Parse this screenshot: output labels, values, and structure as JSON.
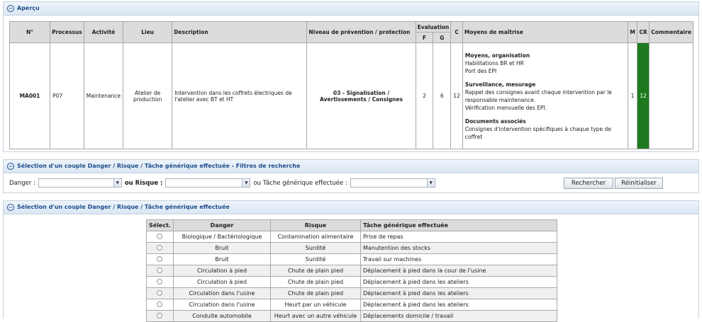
{
  "apercu": {
    "title": "Aperçu",
    "headers": {
      "num": "N°",
      "processus": "Processus",
      "activite": "Activité",
      "lieu": "Lieu",
      "description": "Description",
      "niveau": "Niveau de prévention / protection",
      "evaluation": "Evaluation",
      "f": "F",
      "g": "G",
      "c": "C",
      "moyens": "Moyens de maîtrise",
      "m": "M",
      "cr": "CR",
      "commentaire": "Commentaire"
    },
    "row": {
      "num": "MA001",
      "processus": "P07",
      "activite": "Maintenance",
      "lieu": "Atelier de production",
      "description": "Intervention dans les coffrets électriques de l'atelier avec BT et HT",
      "niveau": "03 - Signalisation / Avertissements / Consignes",
      "f": "2",
      "g": "6",
      "c": "12",
      "m": "1",
      "cr": "12",
      "commentaire": "",
      "moyens": {
        "h1": "Moyens, organisation",
        "l1": "Habilitations BR et HR",
        "l2": "Port des EPI",
        "h2": "Surveillance, mesurage",
        "l3": "Rappel des consignes avant chaque intervention par le responsable maintenance.",
        "l4": "Vérification mensuelle des EPI.",
        "h3": "Documents associés",
        "l5": "Consignes d'intervention spécifiques à chaque type de coffret"
      }
    }
  },
  "filters": {
    "title": "Sélection d'un couple Danger / Risque / Tâche générique effectuée - Filtres de recherche",
    "danger_label": "Danger :",
    "ou_risque_label": "ou Risque :",
    "ou_tache_label": "ou Tâche générique effectuée :",
    "danger_value": "",
    "risque_value": "",
    "tache_value": "",
    "search_button": "Rechercher",
    "reset_button": "Réinitialiser"
  },
  "selection": {
    "title": "Sélection d'un couple Danger / Risque / Tâche générique effectuée",
    "headers": {
      "select": "Sélect.",
      "danger": "Danger",
      "risque": "Risque",
      "tache": "Tâche générique effectuée"
    },
    "rows": [
      {
        "danger": "Biologique / Bactériologique",
        "risque": "Contamination alimentaire",
        "tache": "Prise de repas"
      },
      {
        "danger": "Bruit",
        "risque": "Surdité",
        "tache": "Manutention des stocks"
      },
      {
        "danger": "Bruit",
        "risque": "Surdité",
        "tache": "Travail sur machines"
      },
      {
        "danger": "Circulation à pied",
        "risque": "Chute de plain pied",
        "tache": "Déplacement à pied dans la cour de l'usine"
      },
      {
        "danger": "Circulation à pied",
        "risque": "Chute de plain pied",
        "tache": "Déplacement à pied dans les ateliers"
      },
      {
        "danger": "Circulation dans l'usine",
        "risque": "Chute de plain pied",
        "tache": "Déplacement à pied dans les ateliers"
      },
      {
        "danger": "Circulation dans l'usine",
        "risque": "Heurt par un véhicule",
        "tache": "Déplacement à pied dans les ateliers"
      },
      {
        "danger": "Conduite automobile",
        "risque": "Heurt avec un autre véhicule",
        "tache": "Déplacements domicile / travail"
      }
    ]
  }
}
